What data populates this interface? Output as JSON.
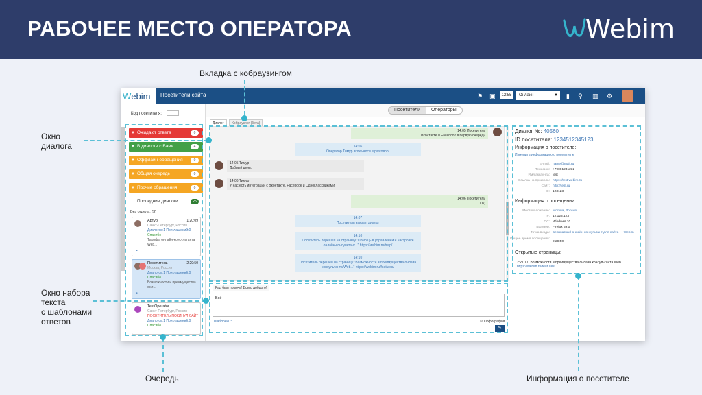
{
  "slide": {
    "title": "РАБОЧЕЕ МЕСТО ОПЕРАТОРА",
    "logo_text": "Webim",
    "callouts": {
      "cobrowse_tab": "Вкладка с кобраузингом",
      "dialog_window": "Окно\nдиалога",
      "compose_window": "Окно набора\nтекста\nс шаблонами\nответов",
      "queue": "Очередь",
      "visitor_info": "Информация о посетителе"
    }
  },
  "app": {
    "logo": "Webim",
    "title": "Посетители сайта",
    "clock": "12:55",
    "status": "Онлайн",
    "visitor_code_label": "Код посетителя:",
    "segment_tabs": [
      "Посетители",
      "Операторы"
    ],
    "dialog_tabs": [
      "Диалог",
      "Кобраузинг (бета)"
    ]
  },
  "queue": {
    "groups": [
      {
        "label": "Ожидают ответа",
        "count": "0",
        "color": "#e53935"
      },
      {
        "label": "В диалоге с Вами",
        "count": "4",
        "color": "#43a047"
      },
      {
        "label": "Оффлайн-обращения",
        "count": "0",
        "color": "#f5a623"
      },
      {
        "label": "Общая очередь",
        "count": "0",
        "color": "#f5a623"
      },
      {
        "label": "Прочие обращения",
        "count": "0",
        "color": "#f5a623"
      }
    ],
    "recent": {
      "label": "Последние диалоги",
      "count": "25"
    },
    "no_department": "Без отдела: (3)",
    "cards": [
      {
        "name": "Артур",
        "time": "1:20:09",
        "geo": "Санкт-Петербург, Россия",
        "line1": "Диалогов:1 Приглашений:0",
        "line2": "Спасибо",
        "line3": "Тарифы онлайн-консультанта Web..."
      },
      {
        "name": "Посетитель",
        "time": "2:29:50",
        "geo": "Москва, Россия",
        "line1": "Диалогов:1 Приглашений:0",
        "line2": "Спасибо",
        "line3": "Возможности и преимущества онл..."
      },
      {
        "name": "TestOperator",
        "time": "",
        "geo": "Санкт-Петербург, Россия",
        "line1": "ПОСЕТИТЕЛЬ ПОКИНУЛ САЙТ",
        "line2": "Диалогов:1 Приглашений:0",
        "line3": "Спасибо"
      }
    ]
  },
  "chat": {
    "messages": [
      {
        "kind": "vis",
        "time": "14:05",
        "author": "Посетитель",
        "text": "Вконтакте и Facebook в первую очередь"
      },
      {
        "kind": "sys",
        "time": "14:06",
        "text": "Оператор Тимур включился в разговор."
      },
      {
        "kind": "op",
        "time": "14:05",
        "author": "Тимур",
        "text": "Добрый день."
      },
      {
        "kind": "op",
        "time": "14:06",
        "author": "Тимур",
        "text": "У нас есть интеграции с Вконтакте, Facebook и Одноклассниками"
      },
      {
        "kind": "vis",
        "time": "14:06",
        "author": "Посетитель",
        "text": "Ок)"
      },
      {
        "kind": "sys",
        "time": "14:07",
        "text": "Посетитель закрыл диалог"
      },
      {
        "kind": "sys",
        "time": "14:10",
        "text": "Посетитель перешел на страницу \"Помощь в управлении и настройке онлайн-консультант...\"",
        "url": "https://webim.ru/help/"
      },
      {
        "kind": "sys",
        "time": "14:10",
        "text": "Посетитель перешел на страницу \"Возможности и преимущества онлайн консультанта Web...\"",
        "url": "https://webim.ru/features/"
      }
    ]
  },
  "compose": {
    "template": "Рад был помочь! Всего доброго!",
    "text": "Всё",
    "templates_link": "Шаблоны ^",
    "spellcheck": "Орфография"
  },
  "visitor": {
    "dialog_label": "Диалог №:",
    "dialog_no": "40560",
    "visitor_id_label": "ID посетителя:",
    "visitor_id": "1234512345123",
    "info_title": "Информация о посетителе:",
    "change_link": "Изменить информацию о посетителе",
    "info_rows": [
      {
        "k": "E-mail:",
        "v": "name@mail.ru",
        "link": true
      },
      {
        "k": "Телефон:",
        "v": "+79001231232",
        "link": false
      },
      {
        "k": "Имя аккаунта:",
        "v": "test",
        "link": false
      },
      {
        "k": "Ссылка на профиль:",
        "v": "https://test.webim.ru",
        "link": true
      },
      {
        "k": "Сайт:",
        "v": "http://test.ru",
        "link": true
      },
      {
        "k": "ID:",
        "v": "123123",
        "link": false
      }
    ],
    "visit_title": "Информация о посещении:",
    "visit_rows": [
      {
        "k": "Местоположение:",
        "v": "Москва, Россия",
        "link": true
      },
      {
        "k": "IP:",
        "v": "12.123.123",
        "link": false
      },
      {
        "k": "ОС:",
        "v": "Windows 10",
        "link": false
      },
      {
        "k": "Браузер:",
        "v": "Firefox 59.0",
        "link": false
      },
      {
        "k": "Точка входа:",
        "v": "Бесплатный онлайн-консультант для сайта — Webim",
        "link": true
      },
      {
        "k": "Общее время посещения:",
        "v": "2:29:50",
        "link": false
      }
    ],
    "pages_title": "Открытые страницы:",
    "pages": [
      {
        "time": "2:21:17",
        "title": "Возможности и преимущества онлайн консультанта Web...",
        "url": "https://webim.ru/features/"
      }
    ]
  }
}
